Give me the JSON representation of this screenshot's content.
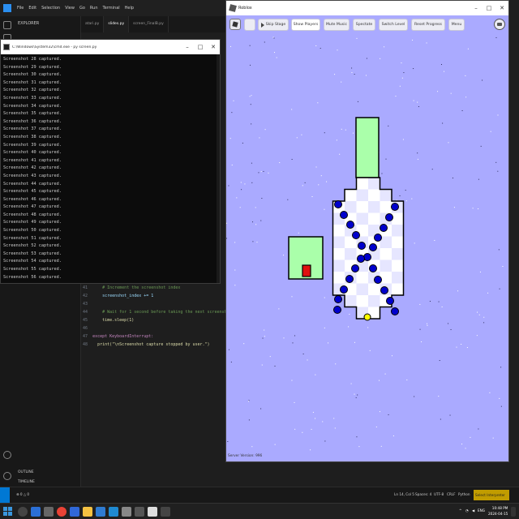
{
  "vscode": {
    "menu": [
      "File",
      "Edit",
      "Selection",
      "View",
      "Go",
      "Run",
      "Terminal",
      "Help"
    ],
    "sidebar_title": "EXPLORER",
    "sidebar_sections": {
      "outline": "OUTLINE",
      "timeline": "TIMELINE"
    },
    "tabs": [
      "atari.py",
      "slides.py",
      "screen_FinalB.py"
    ],
    "code": [
      {
        "ln": "41",
        "text": "# Increment the screenshot index",
        "kind": "comment"
      },
      {
        "ln": "42",
        "text": "screenshot_index += 1",
        "kind": "var"
      },
      {
        "ln": "43",
        "text": "",
        "kind": "blank"
      },
      {
        "ln": "44",
        "text": "# Wait for 1 second before taking the next screenshot",
        "kind": "comment"
      },
      {
        "ln": "45",
        "text": "time.sleep(1)",
        "kind": "fn"
      },
      {
        "ln": "46",
        "text": "",
        "kind": "blank"
      },
      {
        "ln": "47",
        "text": "except KeyboardInterrupt:",
        "kind": "kw"
      },
      {
        "ln": "48",
        "text": "print(\"\\nScreenshot capture stopped by user.\")",
        "kind": "str"
      }
    ],
    "status": {
      "position": "Ln 14, Col 5",
      "spaces": "Spaces: 4",
      "encoding": "UTF-8",
      "eol": "CRLF",
      "language": "Python",
      "interpreter": "Select Interpreter"
    }
  },
  "console": {
    "title": "C:\\Windows\\System32\\cmd.exe - py screen.py",
    "lines": [
      "Screenshot 28 captured.",
      "Screenshot 29 captured.",
      "Screenshot 30 captured.",
      "Screenshot 31 captured.",
      "Screenshot 32 captured.",
      "Screenshot 33 captured.",
      "Screenshot 34 captured.",
      "Screenshot 35 captured.",
      "Screenshot 36 captured.",
      "Screenshot 37 captured.",
      "Screenshot 38 captured.",
      "Screenshot 39 captured.",
      "Screenshot 40 captured.",
      "Screenshot 41 captured.",
      "Screenshot 42 captured.",
      "Screenshot 43 captured.",
      "Screenshot 44 captured.",
      "Screenshot 45 captured.",
      "Screenshot 46 captured.",
      "Screenshot 47 captured.",
      "Screenshot 48 captured.",
      "Screenshot 49 captured.",
      "Screenshot 50 captured.",
      "Screenshot 51 captured.",
      "Screenshot 52 captured.",
      "Screenshot 53 captured.",
      "Screenshot 54 captured.",
      "Screenshot 55 captured.",
      "Screenshot 56 captured."
    ]
  },
  "roblox": {
    "title": "Roblox",
    "buttons": [
      "Skip Stage",
      "Show Players",
      "Mute Music",
      "Spectate",
      "Switch Level",
      "Reset Progress",
      "Menu"
    ],
    "footer": "Server Version: 996",
    "colors": {
      "background": "#aaaaff",
      "safe_zone": "#aaffaa",
      "tile_light": "#ffffff",
      "tile_dark": "#e6e6ff",
      "enemy_dot": "#0000cc",
      "coin": "#ffff00",
      "player": "#e01010"
    }
  },
  "taskbar": {
    "tray": {
      "language": "ENG"
    },
    "time": "10:48 PM",
    "date": "2024-04-15"
  }
}
